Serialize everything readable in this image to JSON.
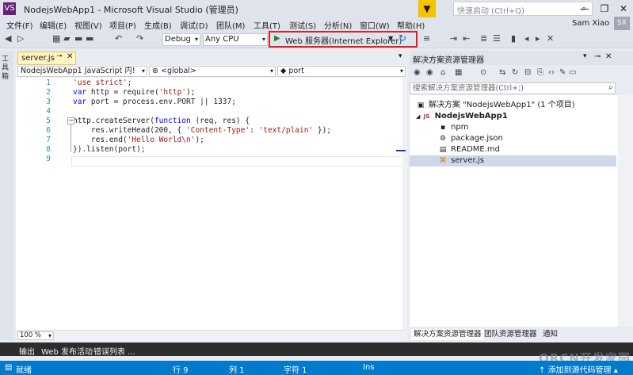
{
  "window": {
    "app_icon": "VS",
    "title": "NodejsWebApp1 - Microsoft Visual Studio (管理员)",
    "filter_icon": "filter-icon",
    "quick_launch_placeholder": "快速启动 (Ctrl+Q)",
    "controls": {
      "minimize": "—",
      "maximize": "❐",
      "close": "✕"
    }
  },
  "menu": {
    "items": [
      "文件(F)",
      "编辑(E)",
      "视图(V)",
      "项目(P)",
      "生成(B)",
      "调试(D)",
      "团队(M)",
      "工具(T)",
      "测试(S)",
      "分析(N)",
      "窗口(W)",
      "帮助(H)"
    ],
    "user_name": "Sam Xiao",
    "user_initials": "SX"
  },
  "toolbar": {
    "configuration": "Debug",
    "platform": "Any CPU",
    "run_label": "Web 服务器(Internet Explorer)"
  },
  "toolbox": {
    "label": "工具箱"
  },
  "editor": {
    "tab_label": "server.js",
    "nav": {
      "project": "NodejsWebApp1 JavaScript 内!",
      "scope": "<global>",
      "member": "port"
    },
    "zoom": "100 %",
    "lines": [
      {
        "num": "1",
        "html": "<span class='str'>'use strict'</span>;"
      },
      {
        "num": "2",
        "html": "<span class='kw'>var</span> http = require(<span class='str'>'http'</span>);"
      },
      {
        "num": "3",
        "html": "<span class='kw'>var</span> port = process.env.PORT || 1337;"
      },
      {
        "num": "4",
        "html": ""
      },
      {
        "num": "5",
        "html": "http.createServer(<span class='kw'>function</span> (req, res) {"
      },
      {
        "num": "6",
        "html": "    res.writeHead(200, { <span class='str'>'Content-Type'</span>: <span class='str'>'text/plain'</span> });"
      },
      {
        "num": "7",
        "html": "    res.end(<span class='str'>'Hello World\\n'</span>);"
      },
      {
        "num": "8",
        "html": "}).listen(port);"
      },
      {
        "num": "9",
        "html": ""
      }
    ]
  },
  "solution_explorer": {
    "title": "解决方案资源管理器",
    "search_placeholder": "搜索解决方案资源管理器(Ctrl+;)",
    "tree": [
      {
        "label": "解决方案 \"NodejsWebApp1\" (1 个项目)",
        "icon": "solution-icon",
        "glyph": "▣",
        "bold": false
      },
      {
        "label": "NodejsWebApp1",
        "icon": "project-icon",
        "glyph": "JS",
        "bold": true,
        "expander": "◢"
      },
      {
        "label": "npm",
        "icon": "npm-icon",
        "glyph": "▪",
        "bold": false
      },
      {
        "label": "package.json",
        "icon": "json-file-icon",
        "glyph": "⚙",
        "bold": false
      },
      {
        "label": "README.md",
        "icon": "markdown-file-icon",
        "glyph": "▤",
        "bold": false
      },
      {
        "label": "server.js",
        "icon": "js-file-icon",
        "glyph": "⌘",
        "bold": false,
        "selected": true
      }
    ],
    "tabs": [
      "解决方案资源管理器",
      "团队资源管理器",
      "通知"
    ]
  },
  "output_tabs": [
    "输出",
    "Web 发布活动",
    "错误列表 ..."
  ],
  "status": {
    "ready": "就绪",
    "row": "行 9",
    "col": "列 1",
    "char": "字符 1",
    "mode": "Ins",
    "source_control": "添加到源代码管理"
  },
  "watermark": "ORCN开发家园"
}
